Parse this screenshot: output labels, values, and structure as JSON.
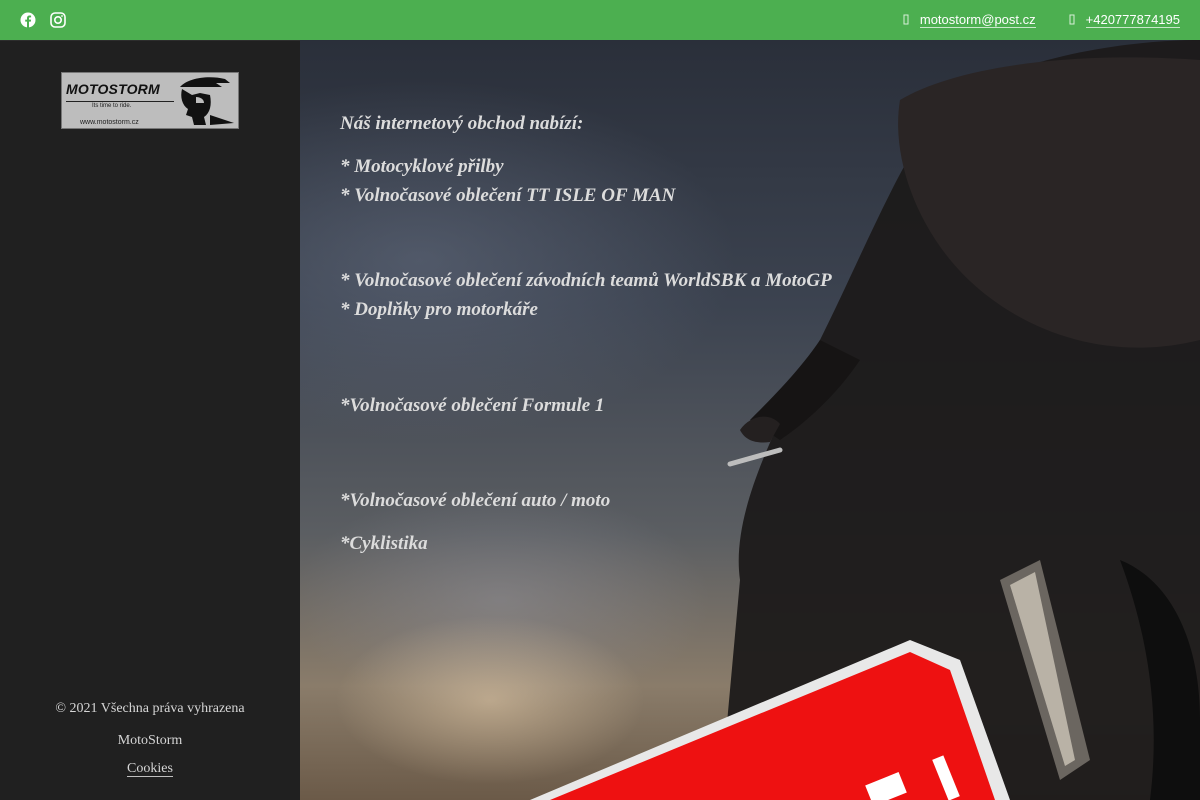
{
  "topbar": {
    "social_icons": [
      "facebook-icon",
      "instagram-icon"
    ],
    "email_icon": "envelope-icon",
    "email": "motostorm@post.cz",
    "phone_icon": "phone-icon",
    "phone": "+420777874195",
    "background_color": "#4caf50"
  },
  "sidebar": {
    "logo": {
      "word": "MOTOSTORM",
      "tagline": "Its time to ride.",
      "url": "www.motostorm.cz"
    },
    "footer": {
      "copyright": "© 2021 Všechna práva vyhrazena",
      "site_name": "MotoStorm",
      "cookies_link": "Cookies"
    }
  },
  "content": {
    "lines": [
      "Náš internetový obchod nabízí:",
      "* Motocyklové přilby",
      "* Volnočasové oblečení TT ISLE OF MAN",
      "* Volnočasové oblečení závodních teamů WorldSBK a MotoGP",
      "* Doplňky pro motorkáře",
      "*Volnočasové oblečení Formule 1",
      "*Volnočasové oblečení auto / moto",
      "*Cyklistika"
    ]
  }
}
